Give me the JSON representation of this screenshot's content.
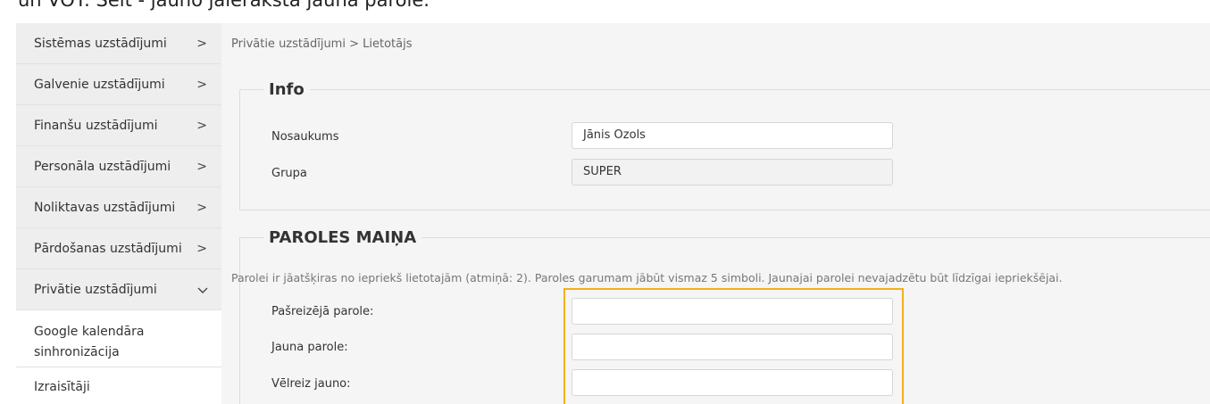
{
  "caption": "un VOT. Šeit - jauno jāieraksta jauna parole.",
  "sidebar": {
    "items": [
      {
        "label": "Sistēmas uzstādījumi",
        "chevron": "chevron-right-icon"
      },
      {
        "label": "Galvenie uzstādījumi",
        "chevron": "chevron-right-icon"
      },
      {
        "label": "Finanšu uzstādījumi",
        "chevron": "chevron-right-icon"
      },
      {
        "label": "Personāla uzstādījumi",
        "chevron": "chevron-right-icon"
      },
      {
        "label": "Noliktavas uzstādījumi",
        "chevron": "chevron-right-icon"
      },
      {
        "label": "Pārdošanas uzstādījumi",
        "chevron": "chevron-right-icon"
      },
      {
        "label": "Privātie uzstādījumi",
        "chevron": "chevron-down-icon"
      }
    ],
    "sub_items": [
      {
        "label": "Google kalendāra sinhronizācija"
      },
      {
        "label": "Izraisītāji"
      }
    ]
  },
  "breadcrumb": "Privātie uzstādījumi > Lietotājs",
  "info": {
    "title": "Info",
    "name_label": "Nosaukums",
    "name_value": "Jānis Ozols",
    "group_label": "Grupa",
    "group_value": "SUPER"
  },
  "password": {
    "title": "PAROLES MAIŅA",
    "hint": "Parolei ir jāatšķiras no iepriekš lietotajām (atmiņā: 2). Paroles garumam jābūt vismaz 5 simboli. Jaunajai parolei nevajadzētu būt līdzīgai iepriekšējai.",
    "current_label": "Pašreizējā parole:",
    "current_value": "",
    "new_label": "Jauna parole:",
    "new_value": "",
    "repeat_label": "Vēlreiz jauno:",
    "repeat_value": ""
  },
  "colors": {
    "highlight": "#f2b01e",
    "sidebar_bg": "#eeeeee",
    "main_bg": "#f5f5f5"
  }
}
